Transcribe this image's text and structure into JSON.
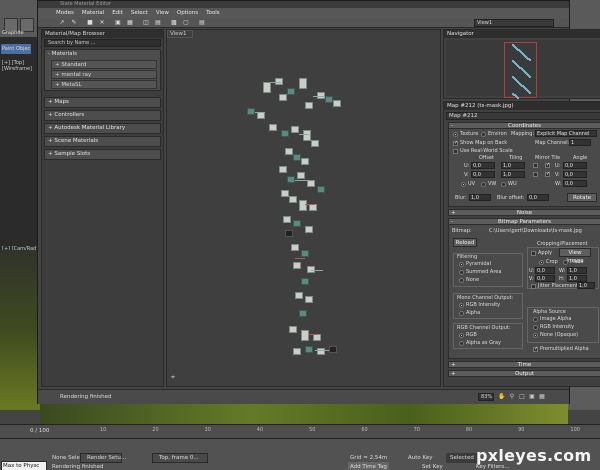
{
  "app": {
    "slate_title": "Slate Material Editor",
    "menu": [
      "Modes",
      "Material",
      "Edit",
      "Select",
      "View",
      "Options",
      "Tools"
    ],
    "view_dropdown": "View1"
  },
  "background": {
    "left_viewport_label": "[+] [Top] [Wireframe]",
    "left_viewport_label2": "[+] [Cam/Rad]",
    "timeline_frame": "0 / 100",
    "timeline_ticks": [
      "0",
      "10",
      "20",
      "30",
      "40",
      "50",
      "60",
      "70",
      "80",
      "90",
      "100"
    ],
    "status_script": "Max to Physc",
    "status_selection": "None Selected",
    "status_render": "Rendering finished",
    "status_task1": "Render Setu...",
    "status_task2": "Top, frame 0...",
    "status_grid": "Grid = 2,54m",
    "status_autokey": "Auto Key",
    "status_selected": "Selected",
    "status_setkey": "Set Key",
    "status_keyfilters": "Key Filters...",
    "status_addtimetag": "Add Time Tag",
    "graphite_tab": "Graphite",
    "paint_tab": "Paint Objec"
  },
  "browser": {
    "title": "Material/Map Browser",
    "search_placeholder": "Search by Name ...",
    "groups": [
      {
        "label": "- Materials",
        "children": [
          "+ Standard",
          "+ mental ray",
          "+ MetaSL"
        ]
      },
      {
        "label": "+ Maps",
        "children": []
      },
      {
        "label": "+ Controllers",
        "children": []
      },
      {
        "label": "+ Autodesk Material Library",
        "children": []
      },
      {
        "label": "+ Scene Materials",
        "children": []
      },
      {
        "label": "+ Sample Slots",
        "children": []
      }
    ]
  },
  "view1": {
    "label": "View1"
  },
  "navigator": {
    "title": "Navigator"
  },
  "params": {
    "title": "Map #212 (ts-mask.jpg)",
    "name_value": "Map #212",
    "coordinates": {
      "title": "Coordinates",
      "texture": "Texture",
      "environ": "Environ",
      "mapping_label": "Mapping:",
      "mapping_value": "Explicit Map Channel",
      "show_map": "Show Map on Back",
      "map_channel_label": "Map Channel:",
      "map_channel_value": "1",
      "real_world": "Use Real-World Scale",
      "offset": "Offset",
      "tiling": "Tiling",
      "mirror_tile": "Mirror Tile",
      "angle": "Angle",
      "u": "U:",
      "v": "V:",
      "w": "W:",
      "u_offset": "0,0",
      "v_offset": "0,0",
      "u_tiling": "1,0",
      "v_tiling": "1,0",
      "u_angle": "0,0",
      "v_angle": "0,0",
      "w_angle": "0,0",
      "uv": "UV",
      "vw": "VW",
      "wu": "WU",
      "blur_label": "Blur:",
      "blur_value": "1,0",
      "blur_offset_label": "Blur offset:",
      "blur_offset_value": "0,0",
      "rotate": "Rotate"
    },
    "noise": {
      "title": "Noise"
    },
    "bitmap": {
      "title": "Bitmap Parameters",
      "bitmap_label": "Bitmap:",
      "bitmap_path": "C:\\Users\\gert\\Downloads\\ts-mask.jpg",
      "reload": "Reload",
      "cropping": "Cropping/Placement",
      "apply": "Apply",
      "view_image": "View Image",
      "crop": "Crop",
      "place": "Place",
      "u": "U:",
      "v": "V:",
      "w": "W:",
      "h": "H:",
      "u_val": "0,0",
      "v_val": "0,0",
      "w_val": "1,0",
      "h_val": "1,0",
      "jitter": "Jitter Placement:",
      "jitter_val": "1,0",
      "filtering": "Filtering",
      "pyramidal": "Pyramidal",
      "summed": "Summed Area",
      "none": "None",
      "mono_title": "Mono Channel Output:",
      "rgb_intensity": "RGB Intensity",
      "alpha": "Alpha",
      "rgb_title": "RGB Channel Output:",
      "rgb": "RGB",
      "alpha_as_gray": "Alpha as Gray",
      "alpha_source": "Alpha Source",
      "image_alpha": "Image Alpha",
      "rgb_intensity2": "RGB Intensity",
      "none_opaque": "None (Opaque)",
      "premult": "Premultiplied Alpha"
    },
    "time": {
      "title": "Time"
    },
    "output": {
      "title": "Output"
    }
  },
  "footer": {
    "status": "Rendering finished",
    "zoom": "83%"
  },
  "watermark": "pxleyes.com"
}
